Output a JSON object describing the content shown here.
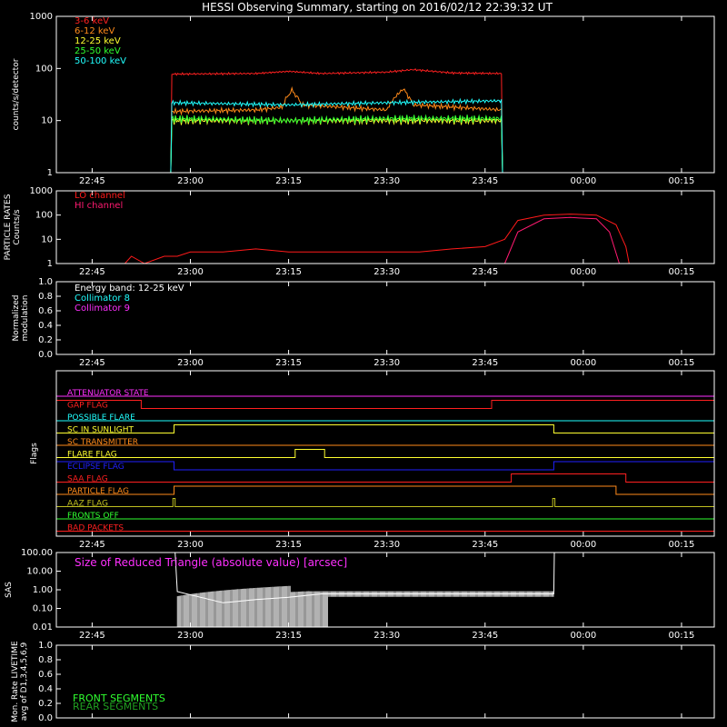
{
  "title": "HESSI Observing Summary, starting on 2016/02/12 22:39:32 UT",
  "time_ticks": [
    "22:45",
    "23:00",
    "23:15",
    "23:30",
    "23:45",
    "00:00",
    "00:15"
  ],
  "chart_data": [
    {
      "type": "line",
      "ylabel": "counts/s/detector",
      "yscale": "log",
      "ylim": [
        1,
        1000
      ],
      "yticks": [
        "1",
        "10",
        "100",
        "1000"
      ],
      "x_units": "UT time",
      "series": [
        {
          "name": "3-6 keV",
          "color": "#ff2020",
          "points": [
            [
              "22:39:32",
              1
            ],
            [
              "22:57:00",
              1
            ],
            [
              "22:57:10",
              78
            ],
            [
              "23:10:00",
              80
            ],
            [
              "23:15:00",
              88
            ],
            [
              "23:20:00",
              80
            ],
            [
              "23:30:00",
              85
            ],
            [
              "23:34:00",
              95
            ],
            [
              "23:40:00",
              82
            ],
            [
              "23:47:30",
              80
            ],
            [
              "23:47:40",
              1
            ],
            [
              "00:20:00",
              1
            ]
          ]
        },
        {
          "name": "6-12 keV",
          "color": "#ff8a1a",
          "points": [
            [
              "22:39:32",
              1
            ],
            [
              "22:57:00",
              1
            ],
            [
              "22:57:10",
              15
            ],
            [
              "23:10:00",
              16
            ],
            [
              "23:14:00",
              18
            ],
            [
              "23:15:30",
              38
            ],
            [
              "23:17:00",
              20
            ],
            [
              "23:30:00",
              16
            ],
            [
              "23:32:30",
              40
            ],
            [
              "23:34:00",
              20
            ],
            [
              "23:47:30",
              16
            ],
            [
              "23:47:40",
              1
            ],
            [
              "00:20:00",
              1
            ]
          ]
        },
        {
          "name": "12-25 keV",
          "color": "#ffff30",
          "points": [
            [
              "22:39:32",
              1
            ],
            [
              "22:57:00",
              1
            ],
            [
              "22:57:10",
              10
            ],
            [
              "23:15:00",
              10
            ],
            [
              "23:30:00",
              10
            ],
            [
              "23:47:30",
              10
            ],
            [
              "23:47:40",
              1
            ],
            [
              "00:20:00",
              1
            ]
          ]
        },
        {
          "name": "25-50 keV",
          "color": "#30ff30",
          "points": [
            [
              "22:39:32",
              1
            ],
            [
              "22:57:00",
              1
            ],
            [
              "22:57:10",
              11
            ],
            [
              "23:15:00",
              10
            ],
            [
              "23:30:00",
              11
            ],
            [
              "23:47:30",
              11
            ],
            [
              "23:47:40",
              1
            ],
            [
              "00:20:00",
              1
            ]
          ]
        },
        {
          "name": "50-100 keV",
          "color": "#20ffff",
          "points": [
            [
              "22:39:32",
              1
            ],
            [
              "22:57:00",
              1
            ],
            [
              "22:57:10",
              22
            ],
            [
              "23:15:00",
              20
            ],
            [
              "23:30:00",
              22
            ],
            [
              "23:47:30",
              24
            ],
            [
              "23:47:40",
              1
            ],
            [
              "00:20:00",
              1
            ]
          ]
        }
      ]
    },
    {
      "type": "line",
      "ylabel": "PARTICLE RATES Counts/s",
      "yscale": "log",
      "ylim": [
        1,
        1000
      ],
      "yticks": [
        "1",
        "10",
        "100",
        "1000"
      ],
      "series": [
        {
          "name": "LO channel",
          "color": "#ff1a1a",
          "points": [
            [
              "22:39:32",
              1
            ],
            [
              "22:50:00",
              1
            ],
            [
              "22:51:00",
              2
            ],
            [
              "22:53:00",
              1
            ],
            [
              "22:56:00",
              2
            ],
            [
              "22:58:00",
              2
            ],
            [
              "23:00:00",
              3
            ],
            [
              "23:05:00",
              3
            ],
            [
              "23:10:00",
              4
            ],
            [
              "23:15:00",
              3
            ],
            [
              "23:20:00",
              3
            ],
            [
              "23:25:00",
              3
            ],
            [
              "23:30:00",
              3
            ],
            [
              "23:35:00",
              3
            ],
            [
              "23:40:00",
              4
            ],
            [
              "23:45:00",
              5
            ],
            [
              "23:48:00",
              10
            ],
            [
              "23:50:00",
              60
            ],
            [
              "23:54:00",
              100
            ],
            [
              "23:58:00",
              110
            ],
            [
              "00:02:00",
              100
            ],
            [
              "00:05:00",
              40
            ],
            [
              "00:06:30",
              5
            ],
            [
              "00:07:00",
              1
            ],
            [
              "00:20:00",
              1
            ]
          ]
        },
        {
          "name": "HI channel",
          "color": "#ff1a70",
          "points": [
            [
              "23:48:00",
              1
            ],
            [
              "23:50:00",
              20
            ],
            [
              "23:54:00",
              70
            ],
            [
              "23:58:00",
              80
            ],
            [
              "00:02:00",
              70
            ],
            [
              "00:04:00",
              20
            ],
            [
              "00:05:30",
              1
            ]
          ]
        }
      ]
    },
    {
      "type": "line",
      "ylabel": "Normalized modulation",
      "ylim": [
        0,
        1
      ],
      "yticks": [
        "0.0",
        "0.2",
        "0.4",
        "0.6",
        "0.8",
        "1.0"
      ],
      "annotation": "Energy band: 12-25 keV",
      "series": [
        {
          "name": "Collimator 8",
          "color": "#20ffff",
          "points": [
            [
              "22:39:32",
              0
            ],
            [
              "00:20:00",
              0
            ]
          ]
        },
        {
          "name": "Collimator 9",
          "color": "#ff30ff",
          "points": [
            [
              "22:39:32",
              0
            ],
            [
              "00:20:00",
              0
            ]
          ]
        }
      ]
    },
    {
      "type": "line",
      "ylabel": "Flags",
      "flags": [
        {
          "name": "ATTENUATOR STATE",
          "color": "#ff30ff",
          "on": []
        },
        {
          "name": "GAP FLAG",
          "color": "#ff2020",
          "on": [
            [
              "22:39:32",
              "22:52:30"
            ],
            [
              "23:46:00",
              "00:20:00"
            ]
          ]
        },
        {
          "name": "POSSIBLE FLARE",
          "color": "#20ffff",
          "on": []
        },
        {
          "name": "SC IN SUNLIGHT",
          "color": "#ffff30",
          "on": [
            [
              "22:57:30",
              "23:55:30"
            ]
          ]
        },
        {
          "name": "SC TRANSMITTER",
          "color": "#ff8a1a",
          "on": []
        },
        {
          "name": "FLARE FLAG",
          "color": "#ffff30",
          "on": [
            [
              "23:16:00",
              "23:20:30"
            ]
          ]
        },
        {
          "name": "ECLIPSE FLAG",
          "color": "#2020ff",
          "on": [
            [
              "22:39:32",
              "22:57:30"
            ],
            [
              "23:55:30",
              "00:20:00"
            ]
          ]
        },
        {
          "name": "SAA FLAG",
          "color": "#ff2020",
          "on": [
            [
              "23:49:00",
              "00:06:30"
            ]
          ]
        },
        {
          "name": "PARTICLE FLAG",
          "color": "#ff8a1a",
          "on": [
            [
              "22:57:30",
              "00:05:00"
            ]
          ]
        },
        {
          "name": "AAZ FLAG",
          "color": "#c0c020",
          "on": [
            [
              "22:57:20",
              "22:57:40"
            ],
            [
              "23:55:20",
              "23:55:40"
            ]
          ]
        },
        {
          "name": "FRONTS OFF",
          "color": "#30ff30",
          "on": []
        },
        {
          "name": "BAD PACKETS",
          "color": "#ff2020",
          "on": []
        }
      ]
    },
    {
      "type": "line",
      "ylabel": "SAS",
      "yscale": "log",
      "ylim": [
        0.01,
        100
      ],
      "yticks": [
        "0.01",
        "0.10",
        "1.00",
        "10.00",
        "100.00"
      ],
      "annotation": "Size of Reduced Triangle (absolute value) [arcsec]",
      "series": [
        {
          "color": "#ffffff",
          "points": [
            [
              "22:57:40",
              100
            ],
            [
              "22:58:00",
              0.8
            ],
            [
              "23:05:00",
              0.2
            ],
            [
              "23:10:00",
              0.3
            ],
            [
              "23:15:00",
              0.4
            ],
            [
              "23:20:00",
              0.6
            ],
            [
              "23:30:00",
              0.6
            ],
            [
              "23:40:00",
              0.6
            ],
            [
              "23:50:00",
              0.6
            ],
            [
              "23:55:30",
              0.6
            ],
            [
              "23:55:35",
              100
            ]
          ]
        }
      ]
    },
    {
      "type": "line",
      "ylabel": "Mon. Rate LIVETIME avg of D1,3,4,5,6,9",
      "ylim": [
        0,
        1
      ],
      "yticks": [
        "0.0",
        "0.2",
        "0.4",
        "0.6",
        "0.8",
        "1.0"
      ],
      "series": [
        {
          "name": "FRONT SEGMENTS",
          "color": "#30ff30",
          "points": []
        },
        {
          "name": "REAR SEGMENTS",
          "color": "#20a020",
          "points": []
        }
      ]
    }
  ]
}
